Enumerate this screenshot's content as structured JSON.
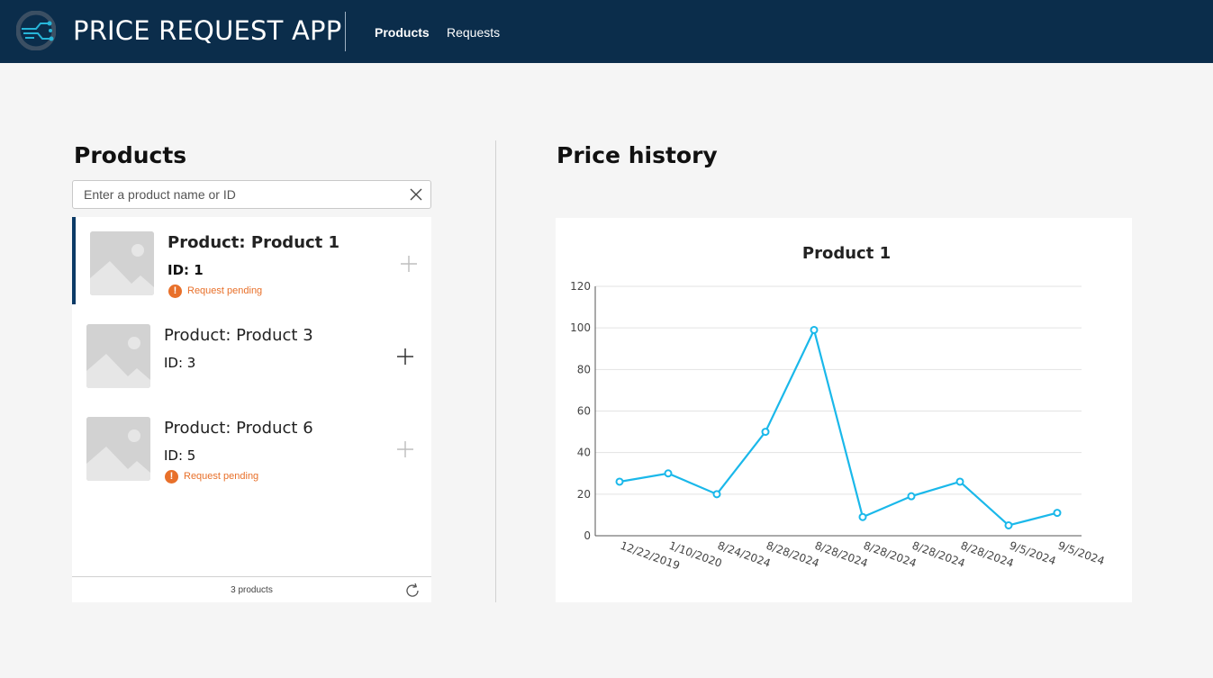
{
  "app": {
    "title": "PRICE REQUEST APP"
  },
  "nav": {
    "items": [
      {
        "label": "Products",
        "active": true
      },
      {
        "label": "Requests",
        "active": false
      }
    ]
  },
  "products_panel": {
    "title": "Products",
    "search": {
      "placeholder": "Enter a product name or ID",
      "value": ""
    },
    "items": [
      {
        "name": "Product: Product 1",
        "id": "ID: 1",
        "status": "Request pending",
        "selected": true
      },
      {
        "name": "Product: Product 3",
        "id": "ID: 3",
        "status": "",
        "selected": false
      },
      {
        "name": "Product: Product 6",
        "id": "ID: 5",
        "status": "Request pending",
        "selected": false
      }
    ],
    "count": "3 products"
  },
  "history_panel": {
    "title": "Price history"
  },
  "colors": {
    "header": "#0b2d4b",
    "accent": "#1ab8ea",
    "pending": "#e8702a",
    "selected_bar": "#0b3a66"
  },
  "icons": {
    "logo": "app-logo-icon",
    "clear": "close-icon",
    "add": "plus-icon",
    "refresh": "refresh-icon",
    "pending": "exclamation-icon",
    "thumb": "image-placeholder-icon"
  },
  "chart_data": {
    "type": "line",
    "title": "Product 1",
    "xlabel": "",
    "ylabel": "",
    "categories": [
      "12/22/2019",
      "1/10/2020",
      "8/24/2024",
      "8/28/2024",
      "8/28/2024",
      "8/28/2024",
      "8/28/2024",
      "8/28/2024",
      "9/5/2024",
      "9/5/2024"
    ],
    "series": [
      {
        "values": [
          26,
          30,
          20,
          50,
          99,
          9,
          19,
          26,
          5,
          11
        ]
      }
    ],
    "ylim": [
      0,
      120
    ],
    "yticks": [
      0,
      20,
      40,
      60,
      80,
      100,
      120
    ],
    "grid": true,
    "color": "#1ab8ea"
  }
}
